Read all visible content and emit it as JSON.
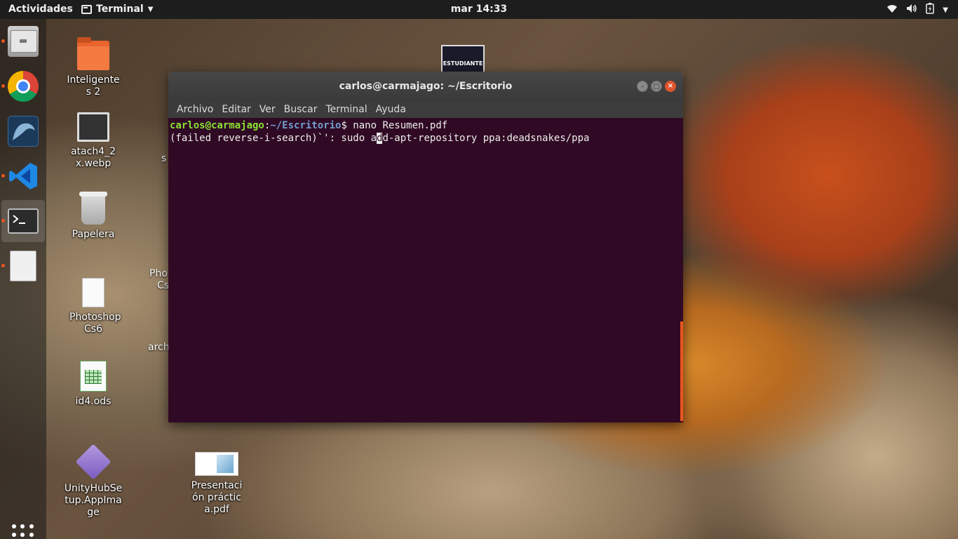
{
  "topbar": {
    "activities": "Actividades",
    "app_menu": "Terminal",
    "clock": "mar 14:33"
  },
  "dock": {
    "items": [
      {
        "name": "files",
        "running": true
      },
      {
        "name": "chrome",
        "running": true
      },
      {
        "name": "mysql-workbench",
        "running": false
      },
      {
        "name": "vscode",
        "running": true
      },
      {
        "name": "terminal",
        "running": true,
        "active": true
      },
      {
        "name": "document-viewer",
        "running": true
      }
    ]
  },
  "desktop": {
    "icons": [
      {
        "label": "Inteligentes 2",
        "icon": "folder-icon"
      },
      {
        "label": "atach4_2x.webp",
        "icon": "image-icon"
      },
      {
        "label": "Papelera",
        "icon": "trash-icon"
      },
      {
        "label": "Photoshop Cs6",
        "icon": "file-icon"
      },
      {
        "label": "id4.ods",
        "icon": "spreadsheet-icon"
      },
      {
        "label": "UnityHubSetup.AppImage",
        "icon": "appimage-icon"
      },
      {
        "label": "Presentación práctica.pdf",
        "icon": "pdf-icon"
      }
    ],
    "peek": {
      "s": "s",
      "pho": "Pho",
      "cs": "Cs",
      "arch": "arch",
      "estudiante": "ESTUDIANTE"
    }
  },
  "terminal": {
    "title": "carlos@carmajago: ~/Escritorio",
    "menu": [
      "Archivo",
      "Editar",
      "Ver",
      "Buscar",
      "Terminal",
      "Ayuda"
    ],
    "prompt_user": "carlos@carmajago",
    "prompt_sep": ":",
    "prompt_path": "~/Escritorio",
    "prompt_end": "$ nano Resumen.pdf",
    "line2_before": "(failed reverse-i-search)`': sudo a",
    "line2_cursor": "d",
    "line2_after": "d-apt-repository ppa:deadsnakes/ppa"
  },
  "colors": {
    "terminal_bg": "#300a24",
    "accent": "#e95420",
    "prompt_user": "#8ae234",
    "prompt_path": "#729fcf"
  }
}
